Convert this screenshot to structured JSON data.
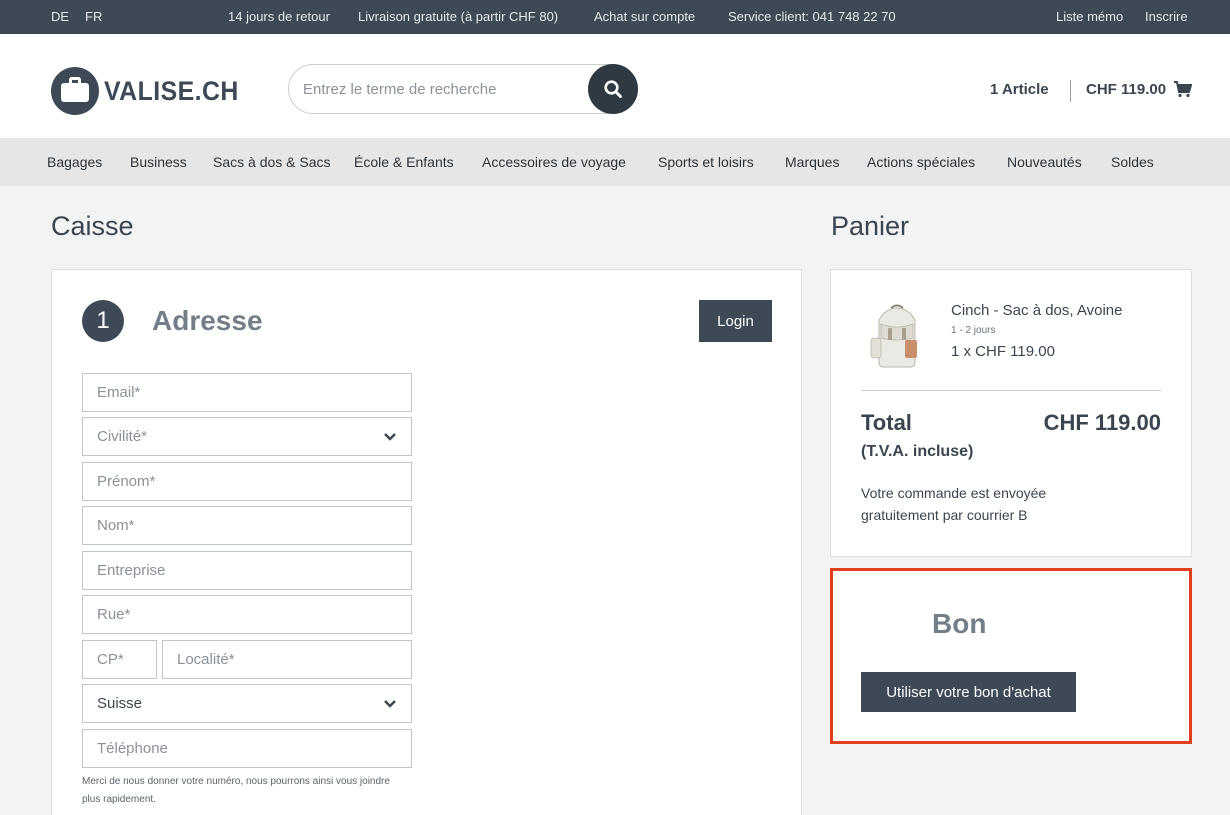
{
  "topbar": {
    "lang_de": "DE",
    "lang_fr": "FR",
    "returns": "14 jours de retour",
    "free_delivery": "Livraison gratuite (à partir CHF 80)",
    "invoice": "Achat sur compte",
    "service": "Service client: 041 748 22 70",
    "wishlist": "Liste mémo",
    "register": "Inscrire"
  },
  "header": {
    "logo_text": "VALISE.CH",
    "search_placeholder": "Entrez le terme de recherche",
    "cart_count": "1  Article",
    "cart_total": "CHF 119.00"
  },
  "nav": {
    "items": [
      "Bagages",
      "Business",
      "Sacs à dos & Sacs",
      "École & Enfants",
      "Accessoires de voyage",
      "Sports et loisirs",
      "Marques",
      "Actions spéciales",
      "Nouveautés",
      "Soldes"
    ]
  },
  "checkout": {
    "title": "Caisse",
    "step_number": "1",
    "step_title": "Adresse",
    "login_label": "Login",
    "fields": {
      "email": "Email*",
      "civility": "Civilité*",
      "firstname": "Prénom*",
      "lastname": "Nom*",
      "company": "Entreprise",
      "street": "Rue*",
      "zip": "CP*",
      "city": "Localité*",
      "country_value": "Suisse",
      "phone": "Téléphone"
    },
    "phone_hint": "Merci de nous donner votre numéro, nous pourrons ainsi vous joindre plus rapidement."
  },
  "cart": {
    "title": "Panier",
    "product_name": "Cinch - Sac à dos, Avoine",
    "delivery_time": "1 - 2 jours",
    "quantity_price": "1 x CHF 119.00",
    "total_label": "Total",
    "total_value": "CHF 119.00",
    "vat_note": "(T.V.A. incluse)",
    "shipping_note": "Votre commande est envoyée gratuitement par courrier B"
  },
  "voucher": {
    "title": "Bon",
    "button_label": "Utiliser votre bon d'achat",
    "highlight_color": "#e2401c"
  },
  "colors": {
    "dark": "#3d4954",
    "accent": "#e2401c"
  }
}
